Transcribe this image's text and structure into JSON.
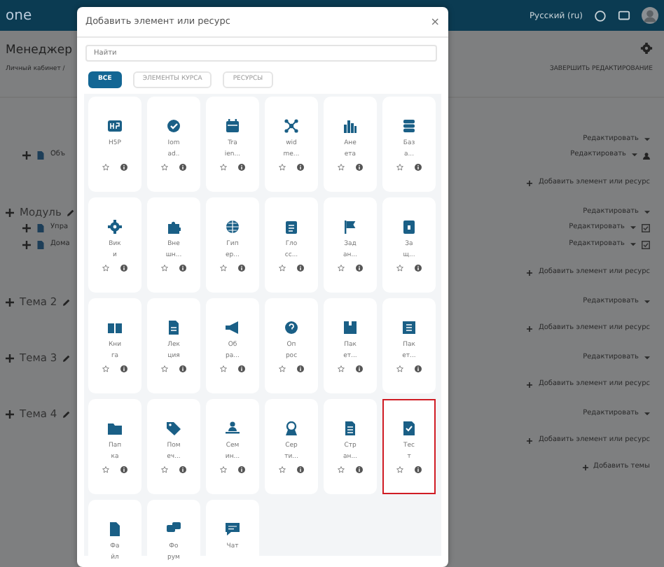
{
  "navbar": {
    "logo": "one",
    "language": "Русский (ru)"
  },
  "header": {
    "title": "Менеджер",
    "breadcrumb": "Личный кабинет /",
    "action": "ЗАВЕРШИТЬ РЕДАКТИРОВАНИЕ"
  },
  "course_rows": [
    {
      "right": {
        "kind": "edit",
        "text": "Редактировать"
      }
    },
    {
      "left": {
        "kind": "activity",
        "text": "Объ"
      },
      "right": {
        "kind": "roles",
        "text": "Редактировать"
      }
    },
    {
      "right": {
        "kind": "add",
        "text": "Добавить элемент или ресурс"
      }
    },
    {
      "left": {
        "kind": "section",
        "text": "Модуль"
      },
      "right": {
        "kind": "edit",
        "text": "Редактировать"
      }
    },
    {
      "left": {
        "kind": "activity",
        "text": "Упра"
      },
      "right": {
        "kind": "edit",
        "text": "Редактировать",
        "checked": true
      }
    },
    {
      "left": {
        "kind": "activity",
        "text": "Дома"
      },
      "right": {
        "kind": "edit",
        "text": "Редактировать",
        "checked": true
      }
    },
    {
      "right": {
        "kind": "add",
        "text": "Добавить элемент или ресурс"
      }
    },
    {
      "left": {
        "kind": "section",
        "text": "Тема 2"
      },
      "right": {
        "kind": "edit",
        "text": "Редактировать"
      }
    },
    {
      "right": {
        "kind": "add",
        "text": "Добавить элемент или ресурс"
      }
    },
    {
      "left": {
        "kind": "section",
        "text": "Тема 3"
      },
      "right": {
        "kind": "edit",
        "text": "Редактировать"
      }
    },
    {
      "right": {
        "kind": "add",
        "text": "Добавить элемент или ресурс"
      }
    },
    {
      "left": {
        "kind": "section",
        "text": "Тема 4"
      },
      "right": {
        "kind": "edit",
        "text": "Редактировать"
      }
    },
    {
      "right": {
        "kind": "add",
        "text": "Добавить элемент или ресурс"
      }
    },
    {
      "right": {
        "kind": "add",
        "text": "Добавить темы"
      }
    }
  ],
  "modal": {
    "title": "Добавить элемент или ресурс",
    "close": "×",
    "search": {
      "placeholder": "Найти"
    },
    "tabs": [
      {
        "label": "ВСЕ",
        "selected": true
      },
      {
        "label": "ЭЛЕМЕНТЫ КУРСА",
        "selected": false
      },
      {
        "label": "РЕСУРСЫ",
        "selected": false
      }
    ],
    "items": [
      {
        "lines": [
          "H5P"
        ],
        "highlighted": false
      },
      {
        "lines": [
          "Iom",
          "ad.."
        ],
        "highlighted": false
      },
      {
        "lines": [
          "Tra",
          "ien..."
        ],
        "highlighted": false
      },
      {
        "lines": [
          "wid",
          "me..."
        ],
        "highlighted": false
      },
      {
        "lines": [
          "Ане",
          "ета"
        ],
        "highlighted": false
      },
      {
        "lines": [
          "Баз",
          "а..."
        ],
        "highlighted": false
      },
      {
        "lines": [
          "Вик",
          "и"
        ],
        "highlighted": false
      },
      {
        "lines": [
          "Вне",
          "шн..."
        ],
        "highlighted": false
      },
      {
        "lines": [
          "Гип",
          "ер..."
        ],
        "highlighted": false
      },
      {
        "lines": [
          "Гло",
          "сс..."
        ],
        "highlighted": false
      },
      {
        "lines": [
          "Зад",
          "ан..."
        ],
        "highlighted": false
      },
      {
        "lines": [
          "За",
          "щ..."
        ],
        "highlighted": false
      },
      {
        "lines": [
          "Кни",
          "га"
        ],
        "highlighted": false
      },
      {
        "lines": [
          "Лек",
          "ция"
        ],
        "highlighted": false
      },
      {
        "lines": [
          "Об",
          "ра..."
        ],
        "highlighted": false
      },
      {
        "lines": [
          "Оп",
          "рос"
        ],
        "highlighted": false
      },
      {
        "lines": [
          "Пак",
          "ет..."
        ],
        "highlighted": false
      },
      {
        "lines": [
          "Пак",
          "ет..."
        ],
        "highlighted": false
      },
      {
        "lines": [
          "Пап",
          "ка"
        ],
        "highlighted": false
      },
      {
        "lines": [
          "Пом",
          "еч..."
        ],
        "highlighted": false
      },
      {
        "lines": [
          "Сем",
          "ин..."
        ],
        "highlighted": false
      },
      {
        "lines": [
          "Сер",
          "ти..."
        ],
        "highlighted": false
      },
      {
        "lines": [
          "Стр",
          "ан..."
        ],
        "highlighted": false
      },
      {
        "lines": [
          "Тес",
          "т"
        ],
        "highlighted": true
      },
      {
        "lines": [
          "Фа",
          "йл"
        ],
        "highlighted": false
      },
      {
        "lines": [
          "Фо",
          "рум"
        ],
        "highlighted": false
      },
      {
        "lines": [
          "Чат"
        ],
        "highlighted": false
      }
    ]
  }
}
